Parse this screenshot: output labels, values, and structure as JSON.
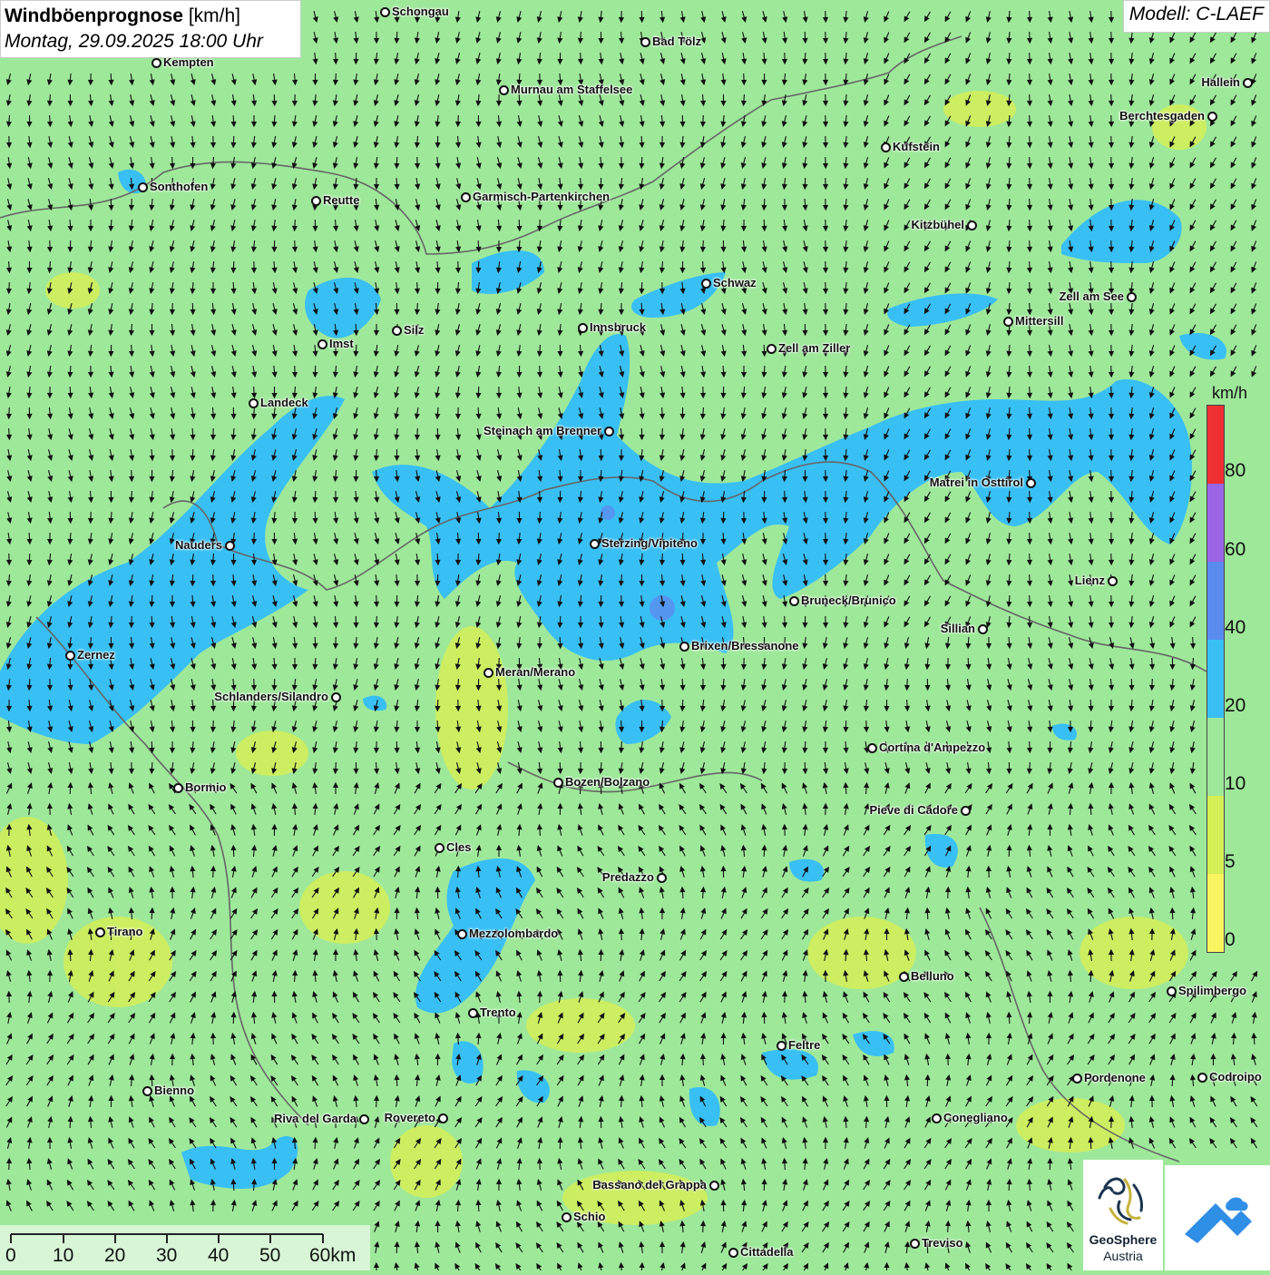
{
  "header": {
    "title_bold": "Windböenprognose",
    "title_unit": "[km/h]",
    "datetime": "Montag, 29.09.2025 18:00 Uhr"
  },
  "model": {
    "label": "Modell: C-LAEF"
  },
  "legend": {
    "unit": "km/h",
    "labels": [
      "80",
      "60",
      "40",
      "20",
      "10",
      "5",
      "0"
    ],
    "colors": [
      "#f03030",
      "#9a66e6",
      "#5a8cf0",
      "#38c0f5",
      "#9ee89a",
      "#d4ee56",
      "#f7f560"
    ]
  },
  "scale": {
    "labels": [
      "0",
      "10",
      "20",
      "30",
      "40",
      "50",
      "60km"
    ]
  },
  "cities": [
    {
      "name": "Schongau"
    },
    {
      "name": "Bad Tölz"
    },
    {
      "name": "Kempten"
    },
    {
      "name": "Murnau am Staffelsee"
    },
    {
      "name": "Hallein"
    },
    {
      "name": "Berchtesgaden"
    },
    {
      "name": "Kufstein"
    },
    {
      "name": "Sonthofen"
    },
    {
      "name": "Reutte"
    },
    {
      "name": "Garmisch-Partenkirchen"
    },
    {
      "name": "Kitzbühel"
    },
    {
      "name": "Schwaz"
    },
    {
      "name": "Zell am See"
    },
    {
      "name": "Mittersill"
    },
    {
      "name": "Innsbruck"
    },
    {
      "name": "Silz"
    },
    {
      "name": "Imst"
    },
    {
      "name": "Zell am Ziller"
    },
    {
      "name": "Landeck"
    },
    {
      "name": "Steinach am Brenner"
    },
    {
      "name": "Matrei in Osttirol"
    },
    {
      "name": "Nauders"
    },
    {
      "name": "Sterzing/Vipiteno"
    },
    {
      "name": "Lienz"
    },
    {
      "name": "Bruneck/Brunico"
    },
    {
      "name": "Sillian"
    },
    {
      "name": "Zernez"
    },
    {
      "name": "Brixen/Bressanone"
    },
    {
      "name": "Meran/Merano"
    },
    {
      "name": "Schlanders/Silandro"
    },
    {
      "name": "Cortina d'Ampezzo"
    },
    {
      "name": "Bozen/Bolzano"
    },
    {
      "name": "Bormio"
    },
    {
      "name": "Pieve di Cadore"
    },
    {
      "name": "Cles"
    },
    {
      "name": "Predazzo"
    },
    {
      "name": "Tirano"
    },
    {
      "name": "Mezzolombardo"
    },
    {
      "name": "Belluno"
    },
    {
      "name": "Spilimbergo"
    },
    {
      "name": "Trento"
    },
    {
      "name": "Feltre"
    },
    {
      "name": "Pordenone"
    },
    {
      "name": "Codroipo"
    },
    {
      "name": "Bienno"
    },
    {
      "name": "Riva del Garda"
    },
    {
      "name": "Rovereto"
    },
    {
      "name": "Conegliano"
    },
    {
      "name": "Bassano del Grappa"
    },
    {
      "name": "Schio"
    },
    {
      "name": "Treviso"
    },
    {
      "name": "Cittadella"
    }
  ],
  "logos": {
    "geosphere_line1": "GeoSphere",
    "geosphere_line2": "Austria"
  },
  "icons": [
    "wind-arrow-icon",
    "geosphere-logo-icon",
    "mountain-logo-icon"
  ]
}
